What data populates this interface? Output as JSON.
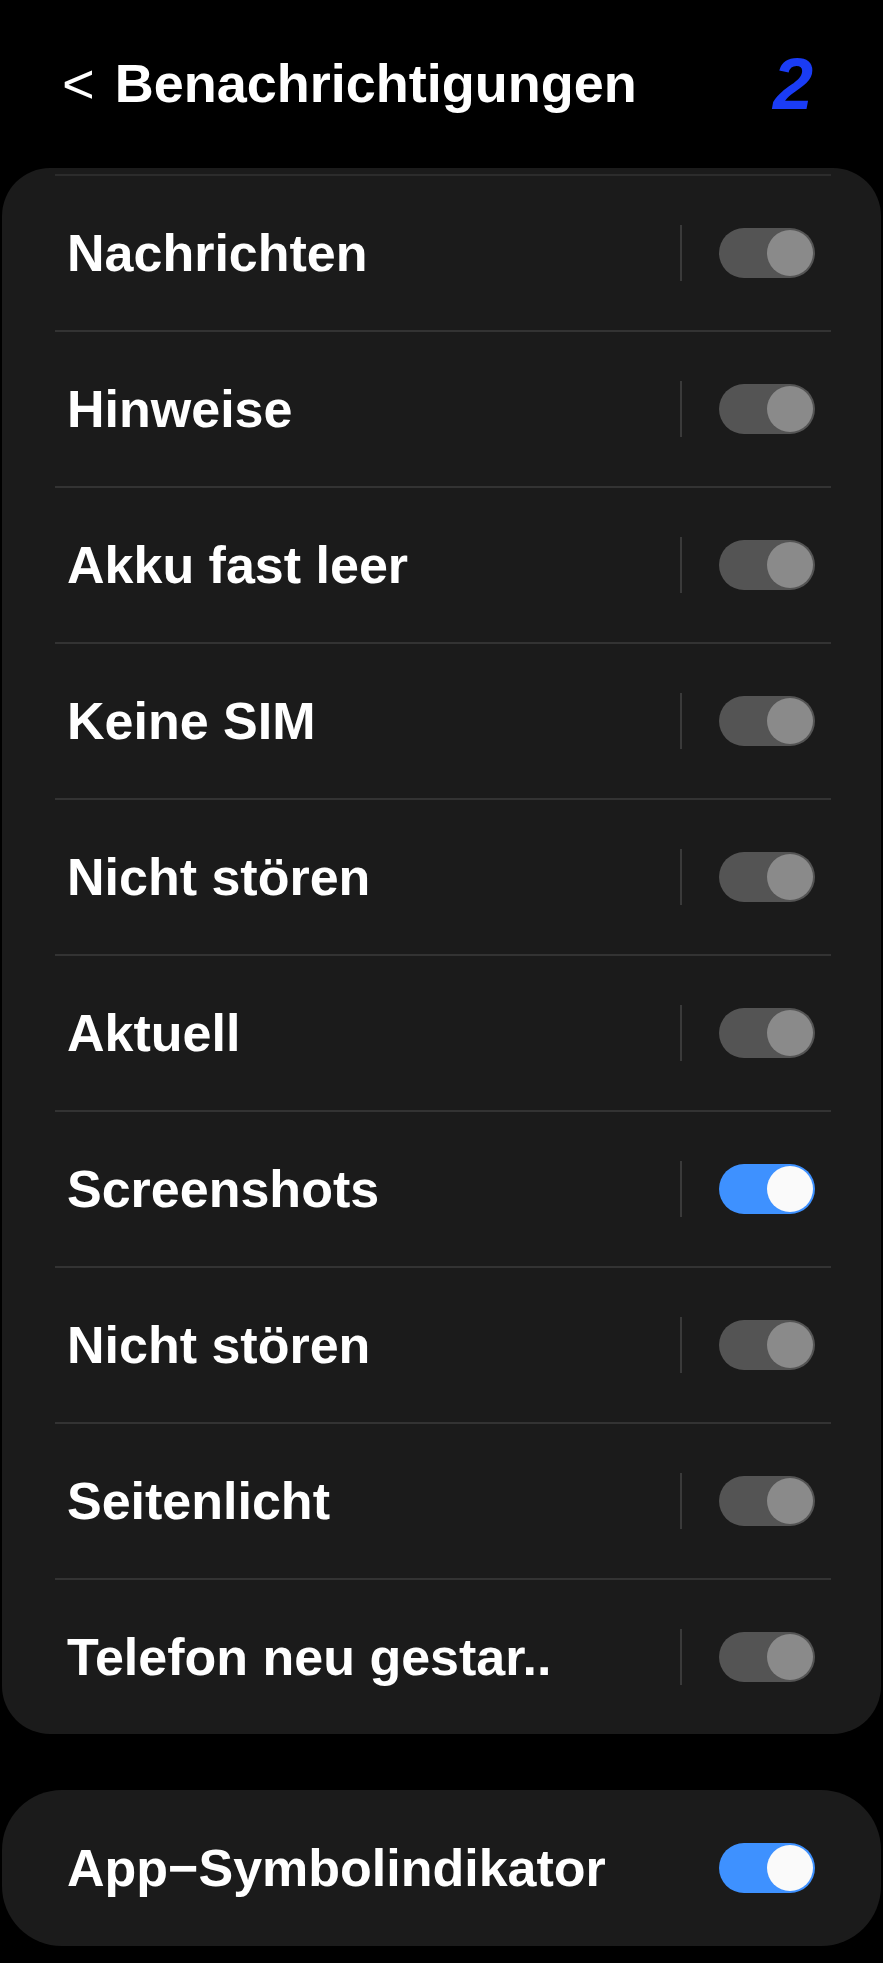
{
  "header": {
    "back": "<",
    "title": "Benachrichtigungen",
    "annotation": "2"
  },
  "settings": [
    {
      "label": "Nachrichten",
      "on": true,
      "disabled": true
    },
    {
      "label": "Hinweise",
      "on": true,
      "disabled": true
    },
    {
      "label": "Akku fast leer",
      "on": true,
      "disabled": true
    },
    {
      "label": "Keine SIM",
      "on": true,
      "disabled": true
    },
    {
      "label": "Nicht stören",
      "on": true,
      "disabled": true
    },
    {
      "label": "Aktuell",
      "on": true,
      "disabled": true
    },
    {
      "label": "Screenshots",
      "on": true,
      "disabled": false
    },
    {
      "label": "Nicht stören",
      "on": true,
      "disabled": true
    },
    {
      "label": "Seitenlicht",
      "on": true,
      "disabled": true
    },
    {
      "label": "Telefon neu gestar..",
      "on": true,
      "disabled": true
    }
  ],
  "app_icon_badge": {
    "label": "App−Symbolindikator",
    "on": true,
    "disabled": false
  }
}
